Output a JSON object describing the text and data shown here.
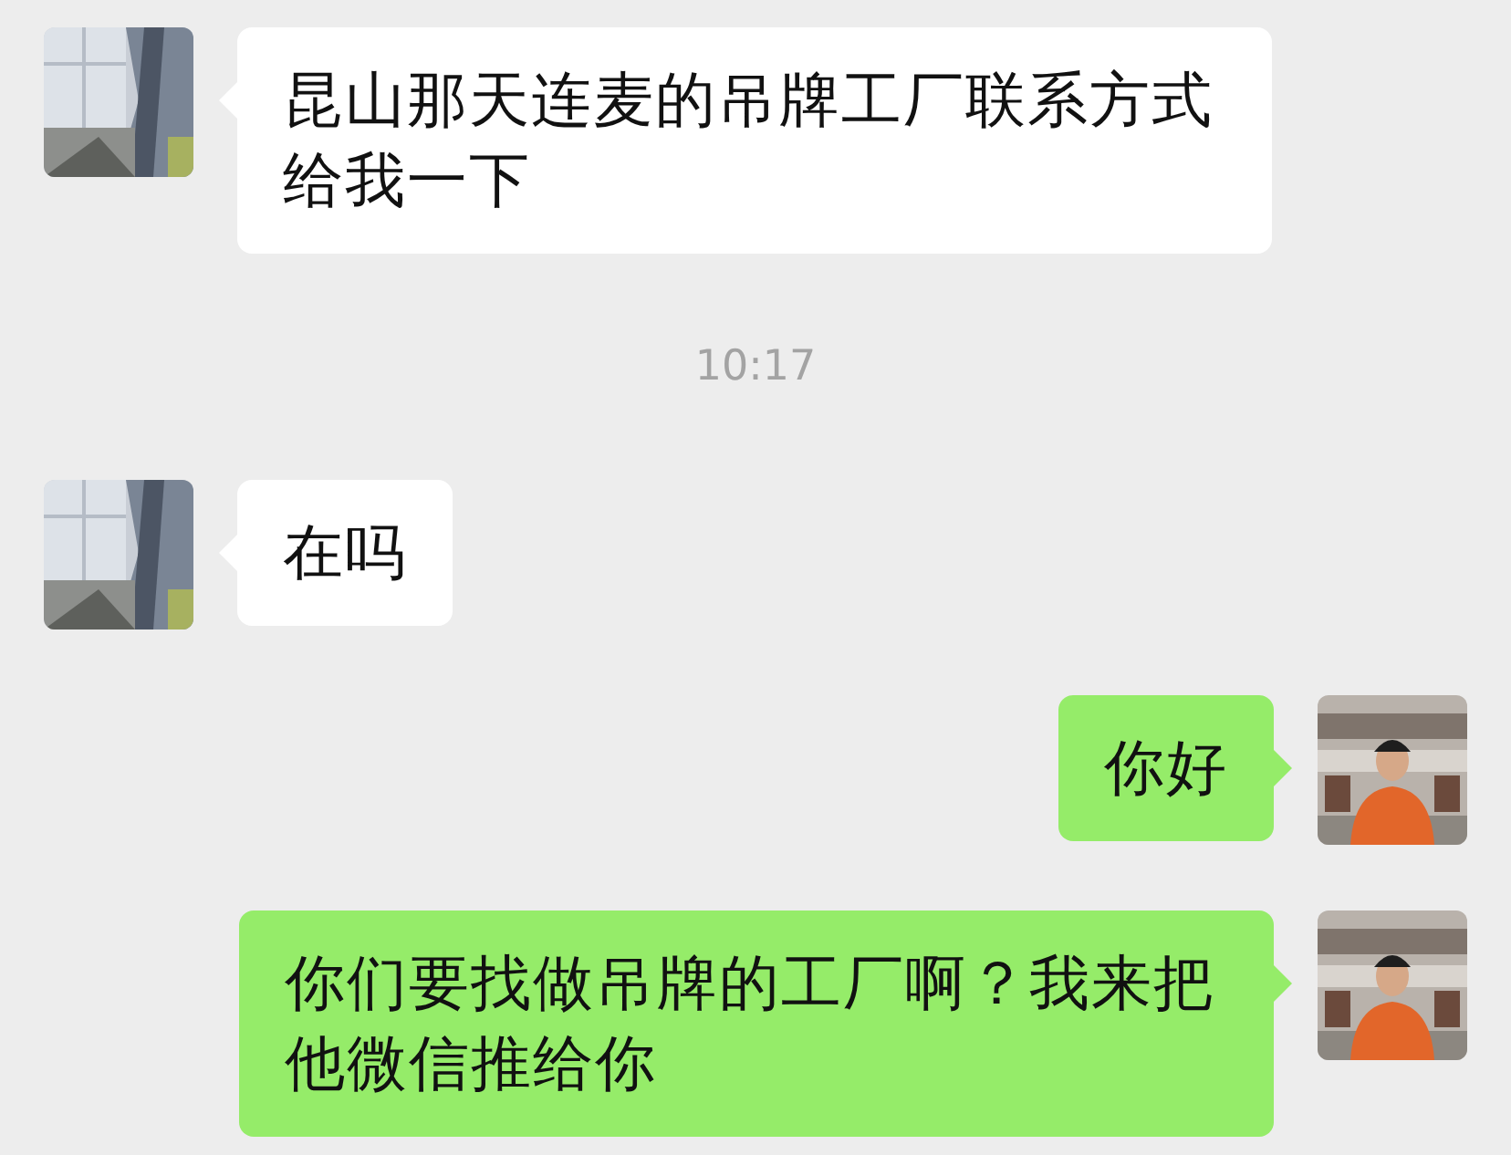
{
  "messages": [
    {
      "kind": "incoming",
      "text": "昆山那天连麦的吊牌工厂联系方式给我一下"
    },
    {
      "kind": "time",
      "text": "10:17"
    },
    {
      "kind": "incoming",
      "text": "在吗"
    },
    {
      "kind": "outgoing",
      "text": "你好"
    },
    {
      "kind": "outgoing",
      "text": "你们要找做吊牌的工厂啊？我来把他微信推给你"
    }
  ]
}
